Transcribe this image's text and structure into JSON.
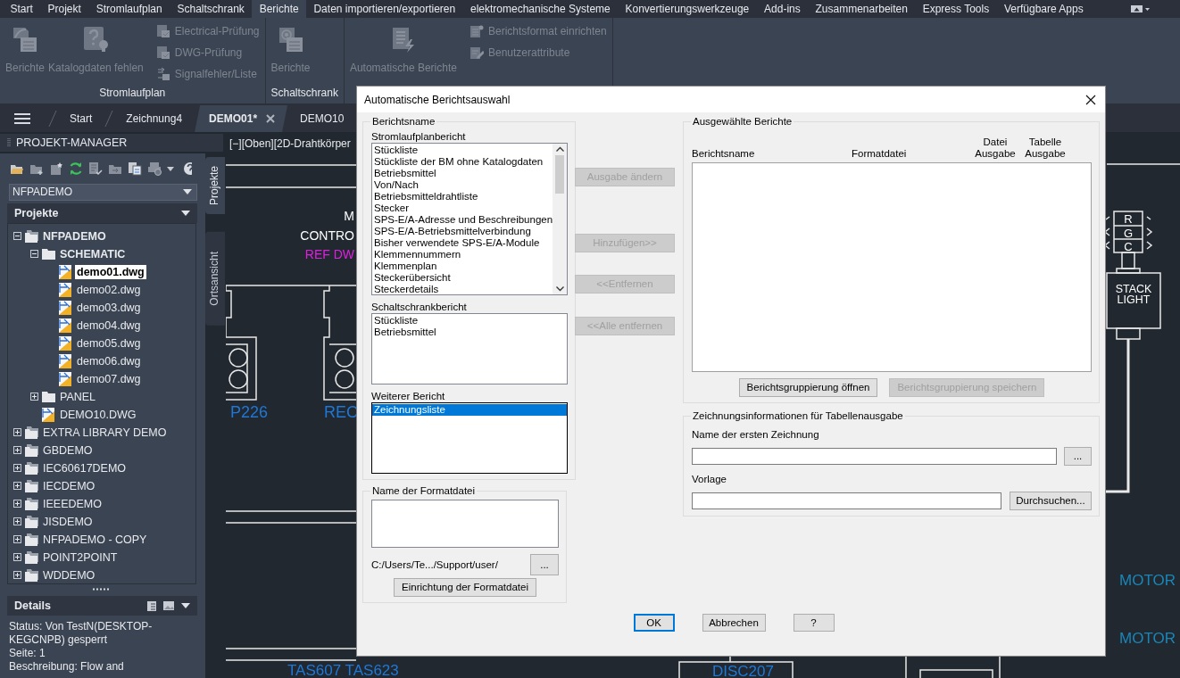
{
  "menu_tabs": [
    {
      "label": "Start",
      "selected": false
    },
    {
      "label": "Projekt",
      "selected": false
    },
    {
      "label": "Stromlaufplan",
      "selected": false
    },
    {
      "label": "Schaltschrank",
      "selected": false
    },
    {
      "label": "Berichte",
      "selected": true
    },
    {
      "label": "Daten importieren/exportieren",
      "selected": false
    },
    {
      "label": "elektromechanische Systeme",
      "selected": false
    },
    {
      "label": "Konvertierungswerkzeuge",
      "selected": false
    },
    {
      "label": "Add-ins",
      "selected": false
    },
    {
      "label": "Zusammenarbeiten",
      "selected": false
    },
    {
      "label": "Express Tools",
      "selected": false
    },
    {
      "label": "Verfügbare Apps",
      "selected": false
    }
  ],
  "ribbon": {
    "panels": [
      {
        "title": "Stromlaufplan",
        "large": [
          {
            "label": "Berichte",
            "disabled": true
          },
          {
            "label": "Katalogdaten fehlen",
            "disabled": true
          }
        ],
        "small": [
          {
            "label": "Electrical-Prüfung",
            "disabled": true
          },
          {
            "label": "DWG-Prüfung",
            "disabled": true
          },
          {
            "label": "Signalfehler/Liste",
            "disabled": true
          }
        ]
      },
      {
        "title": "Schaltschrank",
        "large": [
          {
            "label": "Berichte",
            "disabled": true
          }
        ]
      },
      {
        "large": [
          {
            "label": "Automatische Berichte",
            "disabled": true
          }
        ],
        "small": [
          {
            "label": "Berichtsformat einrichten",
            "disabled": true
          },
          {
            "label": "Benutzerattribute",
            "disabled": true
          }
        ]
      }
    ]
  },
  "doc_tabs": [
    {
      "label": "Start",
      "selected": false
    },
    {
      "label": "Zeichnung4",
      "selected": false
    },
    {
      "label": "DEMO01*",
      "selected": true
    },
    {
      "label": "DEMO10",
      "selected": false
    }
  ],
  "project_manager": {
    "title": "PROJEKT-MANAGER",
    "project": "NFPADEMO",
    "section": "Projekte",
    "tree": [
      {
        "label": "NFPADEMO",
        "kind": "project",
        "active": true,
        "selected": false,
        "expanded": true,
        "children": [
          {
            "label": "SCHEMATIC",
            "kind": "folder",
            "active": true,
            "selected": false,
            "expanded": true,
            "children": [
              {
                "label": "demo01.dwg",
                "kind": "drawing",
                "active": false,
                "selected": true
              },
              {
                "label": "demo02.dwg",
                "kind": "drawing",
                "active": false,
                "selected": false
              },
              {
                "label": "demo03.dwg",
                "kind": "drawing",
                "active": false,
                "selected": false
              },
              {
                "label": "demo04.dwg",
                "kind": "drawing",
                "active": false,
                "selected": false
              },
              {
                "label": "demo05.dwg",
                "kind": "drawing",
                "active": false,
                "selected": false
              },
              {
                "label": "demo06.dwg",
                "kind": "drawing",
                "active": false,
                "selected": false
              },
              {
                "label": "demo07.dwg",
                "kind": "drawing",
                "active": false,
                "selected": false
              }
            ]
          },
          {
            "label": "PANEL",
            "kind": "folder",
            "active": false,
            "selected": false,
            "expanded": false
          },
          {
            "label": "DEMO10.DWG",
            "kind": "drawing",
            "active": false,
            "selected": false
          }
        ]
      },
      {
        "label": "EXTRA LIBRARY DEMO",
        "kind": "project",
        "active": false,
        "selected": false,
        "expanded": false
      },
      {
        "label": "GBDEMO",
        "kind": "project",
        "active": false,
        "selected": false,
        "expanded": false
      },
      {
        "label": "IEC60617DEMO",
        "kind": "project",
        "active": false,
        "selected": false,
        "expanded": false
      },
      {
        "label": "IECDEMO",
        "kind": "project",
        "active": false,
        "selected": false,
        "expanded": false
      },
      {
        "label": "IEEEDEMO",
        "kind": "project",
        "active": false,
        "selected": false,
        "expanded": false
      },
      {
        "label": "JISDEMO",
        "kind": "project",
        "active": false,
        "selected": false,
        "expanded": false
      },
      {
        "label": "NFPADEMO - COPY",
        "kind": "project",
        "active": false,
        "selected": false,
        "expanded": false
      },
      {
        "label": "POINT2POINT",
        "kind": "project",
        "active": false,
        "selected": false,
        "expanded": false
      },
      {
        "label": "WDDEMO",
        "kind": "project",
        "active": false,
        "selected": false,
        "expanded": false
      }
    ],
    "details_title": "Details",
    "details": [
      "Status: Von TestN(DESKTOP-KEGCNPB) gesperrt",
      "Seite: 1",
      "Beschreibung: Flow and"
    ],
    "side_tabs": [
      {
        "label": "Projekte",
        "selected": true
      },
      {
        "label": "Ortsansicht",
        "selected": false
      }
    ]
  },
  "viewport_controls": "[−][Oben][2D-Drahtkörper",
  "drawing_labels": [
    {
      "text": "M",
      "color": "#ffffff"
    },
    {
      "text": "CONTRO",
      "color": "#ffffff"
    },
    {
      "text": "REF DW",
      "color": "#e020e0"
    },
    {
      "text": "P226",
      "color": "#1e78d8"
    },
    {
      "text": "REC",
      "color": "#1e78d8"
    },
    {
      "text": "R",
      "color": "#ffffff"
    },
    {
      "text": "G",
      "color": "#ffffff"
    },
    {
      "text": "C",
      "color": "#ffffff"
    },
    {
      "text": "STACK",
      "color": "#ffffff"
    },
    {
      "text": "LIGHT",
      "color": "#ffffff"
    },
    {
      "text": "MOTOR",
      "color": "#1a86b8"
    },
    {
      "text": "MOTOR",
      "color": "#1a86b8"
    },
    {
      "text": "TAS607 TAS623",
      "color": "#1e78d8"
    },
    {
      "text": "DISC207",
      "color": "#1e78d8"
    }
  ],
  "dialog": {
    "title": "Automatische Berichtsauswahl",
    "report_group": {
      "title": "Berichtsname",
      "lists": [
        {
          "label": "Stromlaufplanbericht",
          "scrollable": true,
          "focused": false,
          "items": [
            {
              "label": "Stückliste",
              "selected": false
            },
            {
              "label": "Stückliste der BM ohne Katalogdaten",
              "selected": false
            },
            {
              "label": "Betriebsmittel",
              "selected": false
            },
            {
              "label": "Von/Nach",
              "selected": false
            },
            {
              "label": "Betriebsmitteldrahtliste",
              "selected": false
            },
            {
              "label": "Stecker",
              "selected": false
            },
            {
              "label": "SPS-E/A-Adresse und Beschreibungen",
              "selected": false
            },
            {
              "label": "SPS-E/A-Betriebsmittelverbindung",
              "selected": false
            },
            {
              "label": "Bisher verwendete SPS-E/A-Module",
              "selected": false
            },
            {
              "label": "Klemmennummern",
              "selected": false
            },
            {
              "label": "Klemmenplan",
              "selected": false
            },
            {
              "label": "Steckerübersicht",
              "selected": false
            },
            {
              "label": "Steckerdetails",
              "selected": false
            }
          ]
        },
        {
          "label": "Schaltschrankbericht",
          "scrollable": false,
          "focused": false,
          "items": [
            {
              "label": "Stückliste",
              "selected": false
            },
            {
              "label": "Betriebsmittel",
              "selected": false
            }
          ]
        },
        {
          "label": "Weiterer Bericht",
          "scrollable": false,
          "focused": true,
          "items": [
            {
              "label": "Zeichnungsliste",
              "selected": true
            }
          ]
        }
      ]
    },
    "format_group": {
      "title": "Name der Formatdatei",
      "path": "C:/Users/Te.../Support/user/",
      "browse": "...",
      "setup": "Einrichtung der Formatdatei"
    },
    "action_buttons": [
      {
        "label": "Ausgabe ändern",
        "disabled": true
      },
      {
        "label": "Hinzufügen>>",
        "disabled": true
      },
      {
        "label": "<<Entfernen",
        "disabled": true
      },
      {
        "label": "<<Alle entfernen",
        "disabled": true
      }
    ],
    "selected_reports": {
      "title": "Ausgewählte Berichte",
      "columns": [
        "Berichtsname",
        "Formatdatei",
        "Datei Ausgabe",
        "Tabelle Ausgabe"
      ],
      "buttons": [
        {
          "label": "Berichtsgruppierung öffnen",
          "disabled": false
        },
        {
          "label": "Berichtsgruppierung speichern",
          "disabled": true
        }
      ]
    },
    "drawing_info": {
      "title": "Zeichnungsinformationen für Tabellenausgabe",
      "fields": [
        {
          "label": "Name der ersten Zeichnung",
          "button": "..."
        },
        {
          "label": "Vorlage",
          "button": "Durchsuchen..."
        }
      ]
    },
    "footer_buttons": [
      {
        "label": "OK",
        "default": true
      },
      {
        "label": "Abbrechen",
        "default": false
      },
      {
        "label": "?",
        "default": false
      }
    ]
  }
}
